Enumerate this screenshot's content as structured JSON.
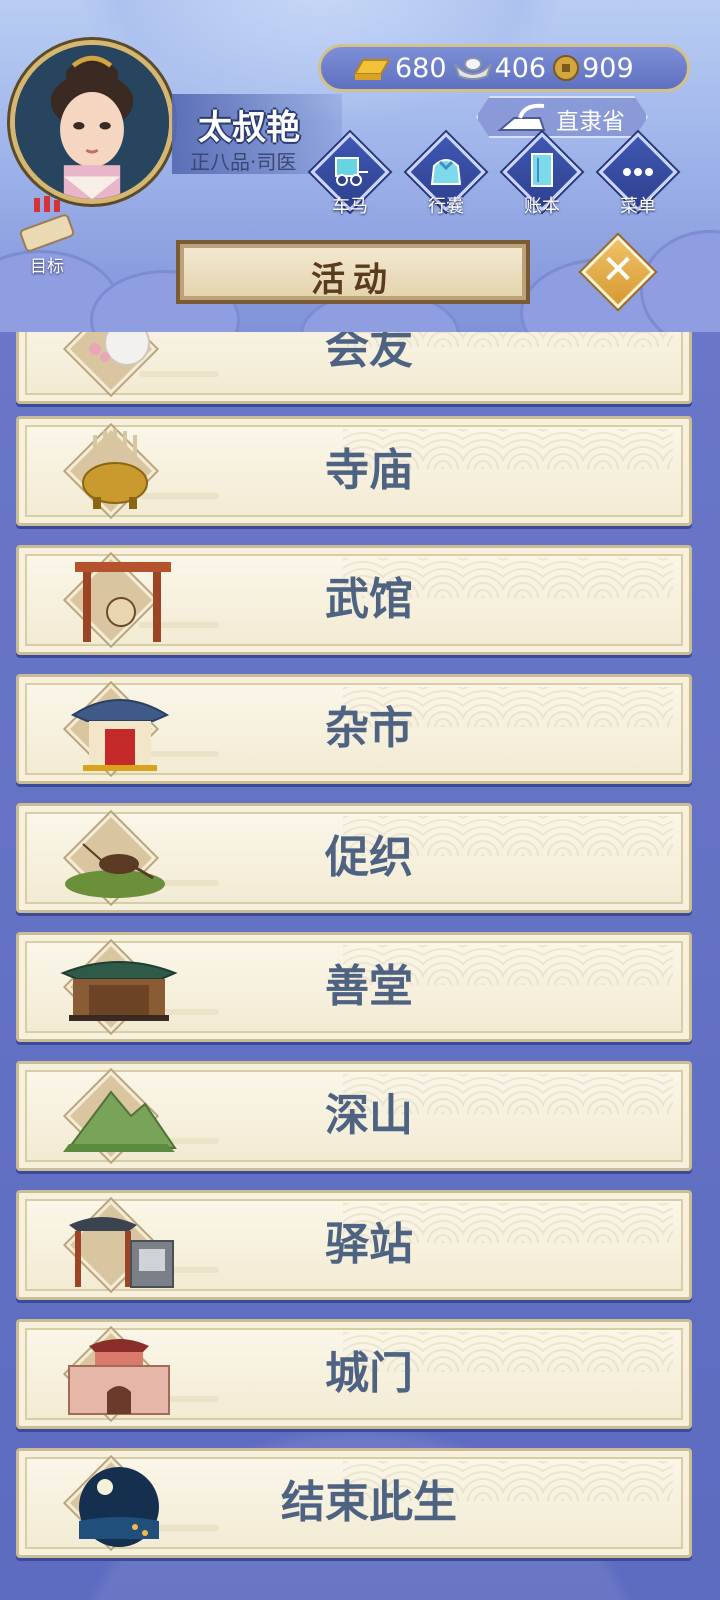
{
  "player": {
    "name": "太叔艳",
    "rank": "正八品·司医"
  },
  "currency": {
    "gold": "680",
    "silver": "406",
    "copper": "909"
  },
  "region": {
    "label": "直隶省"
  },
  "nav": {
    "carriage": "车马",
    "bag": "行囊",
    "ledger": "账本",
    "menu": "菜单",
    "goal": "目标"
  },
  "page": {
    "title": "活动"
  },
  "activities": [
    {
      "label": "会友"
    },
    {
      "label": "寺庙"
    },
    {
      "label": "武馆"
    },
    {
      "label": "杂市"
    },
    {
      "label": "促织"
    },
    {
      "label": "善堂"
    },
    {
      "label": "深山"
    },
    {
      "label": "驿站"
    },
    {
      "label": "城门"
    },
    {
      "label": "结束此生"
    }
  ],
  "colors": {
    "accent": "#d79a34",
    "card_text": "#4e6282",
    "frame_gold": "#d6b771",
    "background": "#6b78c9"
  },
  "icons": [
    "gold-ingot-icon",
    "silver-ingot-icon",
    "copper-coin-icon",
    "iron-icon",
    "carriage-icon",
    "bag-icon",
    "ledger-icon",
    "menu-dots-icon",
    "scroll-icon",
    "close-icon"
  ]
}
